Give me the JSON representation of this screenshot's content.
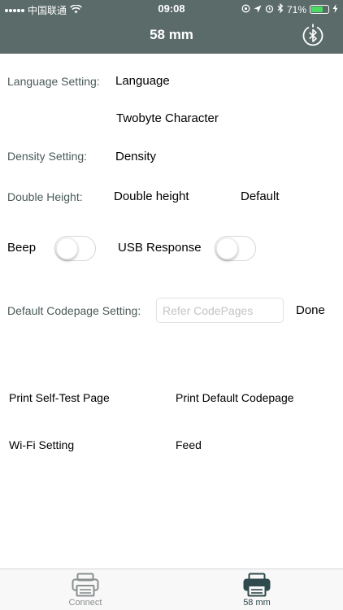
{
  "status_bar": {
    "carrier": "中国联通",
    "time": "09:08",
    "battery": "71%",
    "battery_level": 0.71
  },
  "header": {
    "title": "58 mm",
    "bluetooth_icon": "bluetooth-icon"
  },
  "settings": {
    "language": {
      "label": "Language Setting:",
      "value": "Language",
      "sub_value": "Twobyte Character"
    },
    "density": {
      "label": "Density Setting:",
      "value": "Density"
    },
    "double_height": {
      "label": "Double Height:",
      "value": "Double height",
      "default": "Default"
    },
    "beep": {
      "label": "Beep",
      "on": false
    },
    "usb_response": {
      "label": "USB Response",
      "on": false
    },
    "codepage": {
      "label": "Default Codepage Setting:",
      "placeholder": "Refer CodePages",
      "value": "",
      "done": "Done"
    }
  },
  "actions": {
    "self_test": "Print Self-Test Page",
    "default_codepage": "Print Default Codepage",
    "wifi": "Wi-Fi Setting",
    "feed": "Feed"
  },
  "tabbar": {
    "tabs": [
      {
        "label": "Connect",
        "icon": "printer-icon",
        "active": false
      },
      {
        "label": "58 mm",
        "icon": "printer-icon",
        "active": true
      }
    ]
  },
  "colors": {
    "header_bg": "#5b6b69",
    "label": "#4a5a59",
    "tab_active": "#2f4a4c",
    "tab_inactive": "#8a8f8f"
  }
}
